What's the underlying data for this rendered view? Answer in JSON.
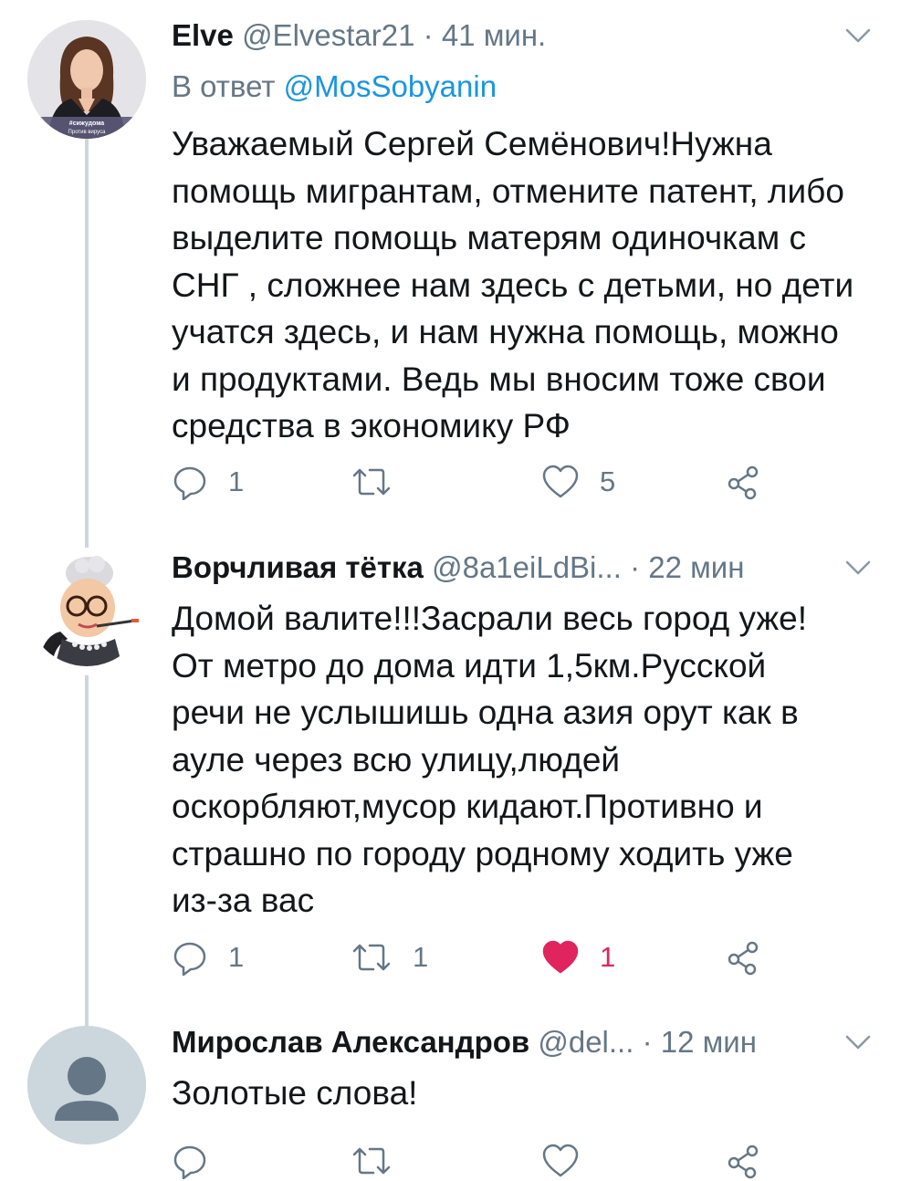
{
  "tweets": [
    {
      "name": "Elve",
      "handle": "@Elvestar21",
      "dot": "·",
      "time": "41 мин.",
      "reply_prefix": "В ответ ",
      "reply_to": "@MosSobyanin",
      "avatar_caption_1": "#сижудома",
      "avatar_caption_2": "Против вируса",
      "lines": [
        "Уважаемый Сергей Семёнович!Нужна",
        "помощь мигрантам, отмените патент, либо",
        "выделите помощь матерям одиночкам с",
        "СНГ , сложнее нам здесь с детьми, но дети",
        "учатся здесь, и нам нужна помощь, можно",
        "и продуктами. Ведь мы вносим тоже свои",
        "средства в экономику РФ"
      ],
      "replies": "1",
      "retweets": "",
      "likes": "5",
      "liked": false
    },
    {
      "name": "Ворчливая тётка",
      "handle": "@8a1eiLdBi...",
      "dot": "·",
      "time": "22 мин",
      "lines": [
        "Домой валите!!!Засрали весь город уже!",
        "От метро до дома идти 1,5км.Русской",
        "речи не услышишь одна азия орут как в",
        "ауле через всю улицу,людей",
        "оскорбляют,мусор кидают.Противно и",
        "страшно по городу родному ходить уже",
        "из-за вас"
      ],
      "replies": "1",
      "retweets": "1",
      "likes": "1",
      "liked": true
    },
    {
      "name": "Мирослав Александров",
      "handle": "@del...",
      "dot": "·",
      "time": "12 мин",
      "lines": [
        "Золотые слова!"
      ],
      "replies": "",
      "retweets": "",
      "likes": "",
      "liked": false
    }
  ],
  "icons": {
    "reply": "reply-icon",
    "retweet": "retweet-icon",
    "like": "heart-icon",
    "share": "share-icon",
    "menu": "chevron-down-icon"
  },
  "colors": {
    "text": "#14171a",
    "secondary": "#657786",
    "link": "#1b95e0",
    "like_active": "#e0245e",
    "thread_line": "#ccd6dd"
  }
}
